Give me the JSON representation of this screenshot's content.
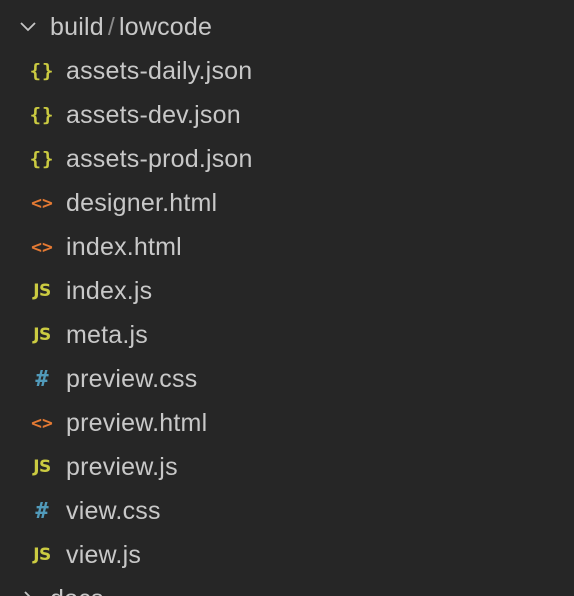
{
  "explorer": {
    "open_folder": {
      "path_part_1": "build",
      "separator": "/",
      "path_part_2": "lowcode",
      "chevron_icon": "chevron-down-icon"
    },
    "files": [
      {
        "name": "assets-daily.json",
        "icon": "json-file-icon",
        "glyph": "{}"
      },
      {
        "name": "assets-dev.json",
        "icon": "json-file-icon",
        "glyph": "{}"
      },
      {
        "name": "assets-prod.json",
        "icon": "json-file-icon",
        "glyph": "{}"
      },
      {
        "name": "designer.html",
        "icon": "html-file-icon",
        "glyph": "<>"
      },
      {
        "name": "index.html",
        "icon": "html-file-icon",
        "glyph": "<>"
      },
      {
        "name": "index.js",
        "icon": "js-file-icon",
        "glyph": "JS"
      },
      {
        "name": "meta.js",
        "icon": "js-file-icon",
        "glyph": "JS"
      },
      {
        "name": "preview.css",
        "icon": "css-file-icon",
        "glyph": "#"
      },
      {
        "name": "preview.html",
        "icon": "html-file-icon",
        "glyph": "<>"
      },
      {
        "name": "preview.js",
        "icon": "js-file-icon",
        "glyph": "JS"
      },
      {
        "name": "view.css",
        "icon": "css-file-icon",
        "glyph": "#"
      },
      {
        "name": "view.js",
        "icon": "js-file-icon",
        "glyph": "JS"
      }
    ],
    "next_folder": {
      "label": "docs",
      "chevron_icon": "chevron-right-icon"
    },
    "colors": {
      "background": "#262626",
      "text": "#c8c8c8",
      "json_icon": "#cbcb41",
      "html_icon": "#e37933",
      "js_icon": "#cbcb41",
      "css_icon": "#519aba"
    }
  }
}
